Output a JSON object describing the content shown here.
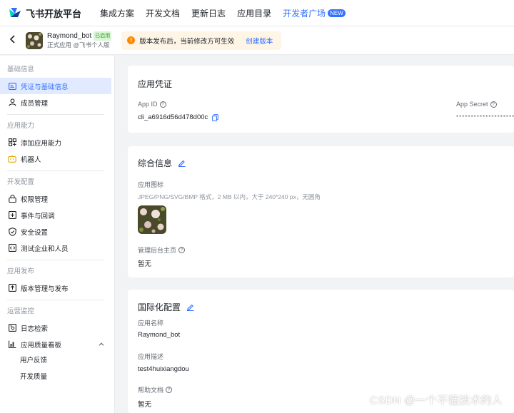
{
  "brand": {
    "name": "飞书开放平台"
  },
  "nav": {
    "items": [
      "集成方案",
      "开发文档",
      "更新日志",
      "应用目录"
    ],
    "dev_square": "开发者广场",
    "new_badge": "NEW"
  },
  "app": {
    "name": "Raymond_bot",
    "status": "已启用",
    "subtitle": "正式应用 @飞书个人版"
  },
  "notice": {
    "text": "版本发布后，当前修改方可生效",
    "link": "创建版本"
  },
  "sidebar": {
    "groups": [
      {
        "title": "基础信息",
        "items": [
          {
            "label": "凭证与基础信息",
            "icon": "credential-icon"
          },
          {
            "label": "成员管理",
            "icon": "member-icon"
          }
        ]
      },
      {
        "title": "应用能力",
        "items": [
          {
            "label": "添加应用能力",
            "icon": "add-ability-icon"
          },
          {
            "label": "机器人",
            "icon": "robot-icon"
          }
        ]
      },
      {
        "title": "开发配置",
        "items": [
          {
            "label": "权限管理",
            "icon": "permission-icon"
          },
          {
            "label": "事件与回调",
            "icon": "event-icon"
          },
          {
            "label": "安全设置",
            "icon": "shield-icon"
          },
          {
            "label": "测试企业和人员",
            "icon": "test-icon"
          }
        ]
      },
      {
        "title": "应用发布",
        "items": [
          {
            "label": "版本管理与发布",
            "icon": "upload-icon"
          }
        ]
      },
      {
        "title": "运营监控",
        "items": [
          {
            "label": "日志检索",
            "icon": "log-icon"
          },
          {
            "label": "应用质量看板",
            "icon": "chart-icon"
          }
        ]
      }
    ],
    "quality_sub": [
      "用户反馈",
      "开发质量"
    ]
  },
  "credentials": {
    "title": "应用凭证",
    "app_id_label": "App ID",
    "app_id": "cli_a6916d56d478d00c",
    "app_secret_label": "App Secret",
    "app_secret": "********************"
  },
  "general": {
    "title": "综合信息",
    "icon_label": "应用图标",
    "icon_hint": "JPEG/PNG/SVG/BMP 格式，2 MB 以内，大于 240*240 px，无圆角",
    "homepage_label": "管理后台主页",
    "homepage_value": "暂无"
  },
  "i18n": {
    "title": "国际化配置",
    "name_label": "应用名称",
    "name_value": "Raymond_bot",
    "desc_label": "应用描述",
    "desc_value": "test4huixiangdou",
    "help_label": "帮助文档",
    "help_value": "暂无"
  },
  "watermark": "CSDN @一个不懂技术的人",
  "colors": {
    "accent": "#3370ff",
    "active_bg": "#e1eaff",
    "warning": "#ff8800",
    "notice_bg": "#fef5e7"
  }
}
